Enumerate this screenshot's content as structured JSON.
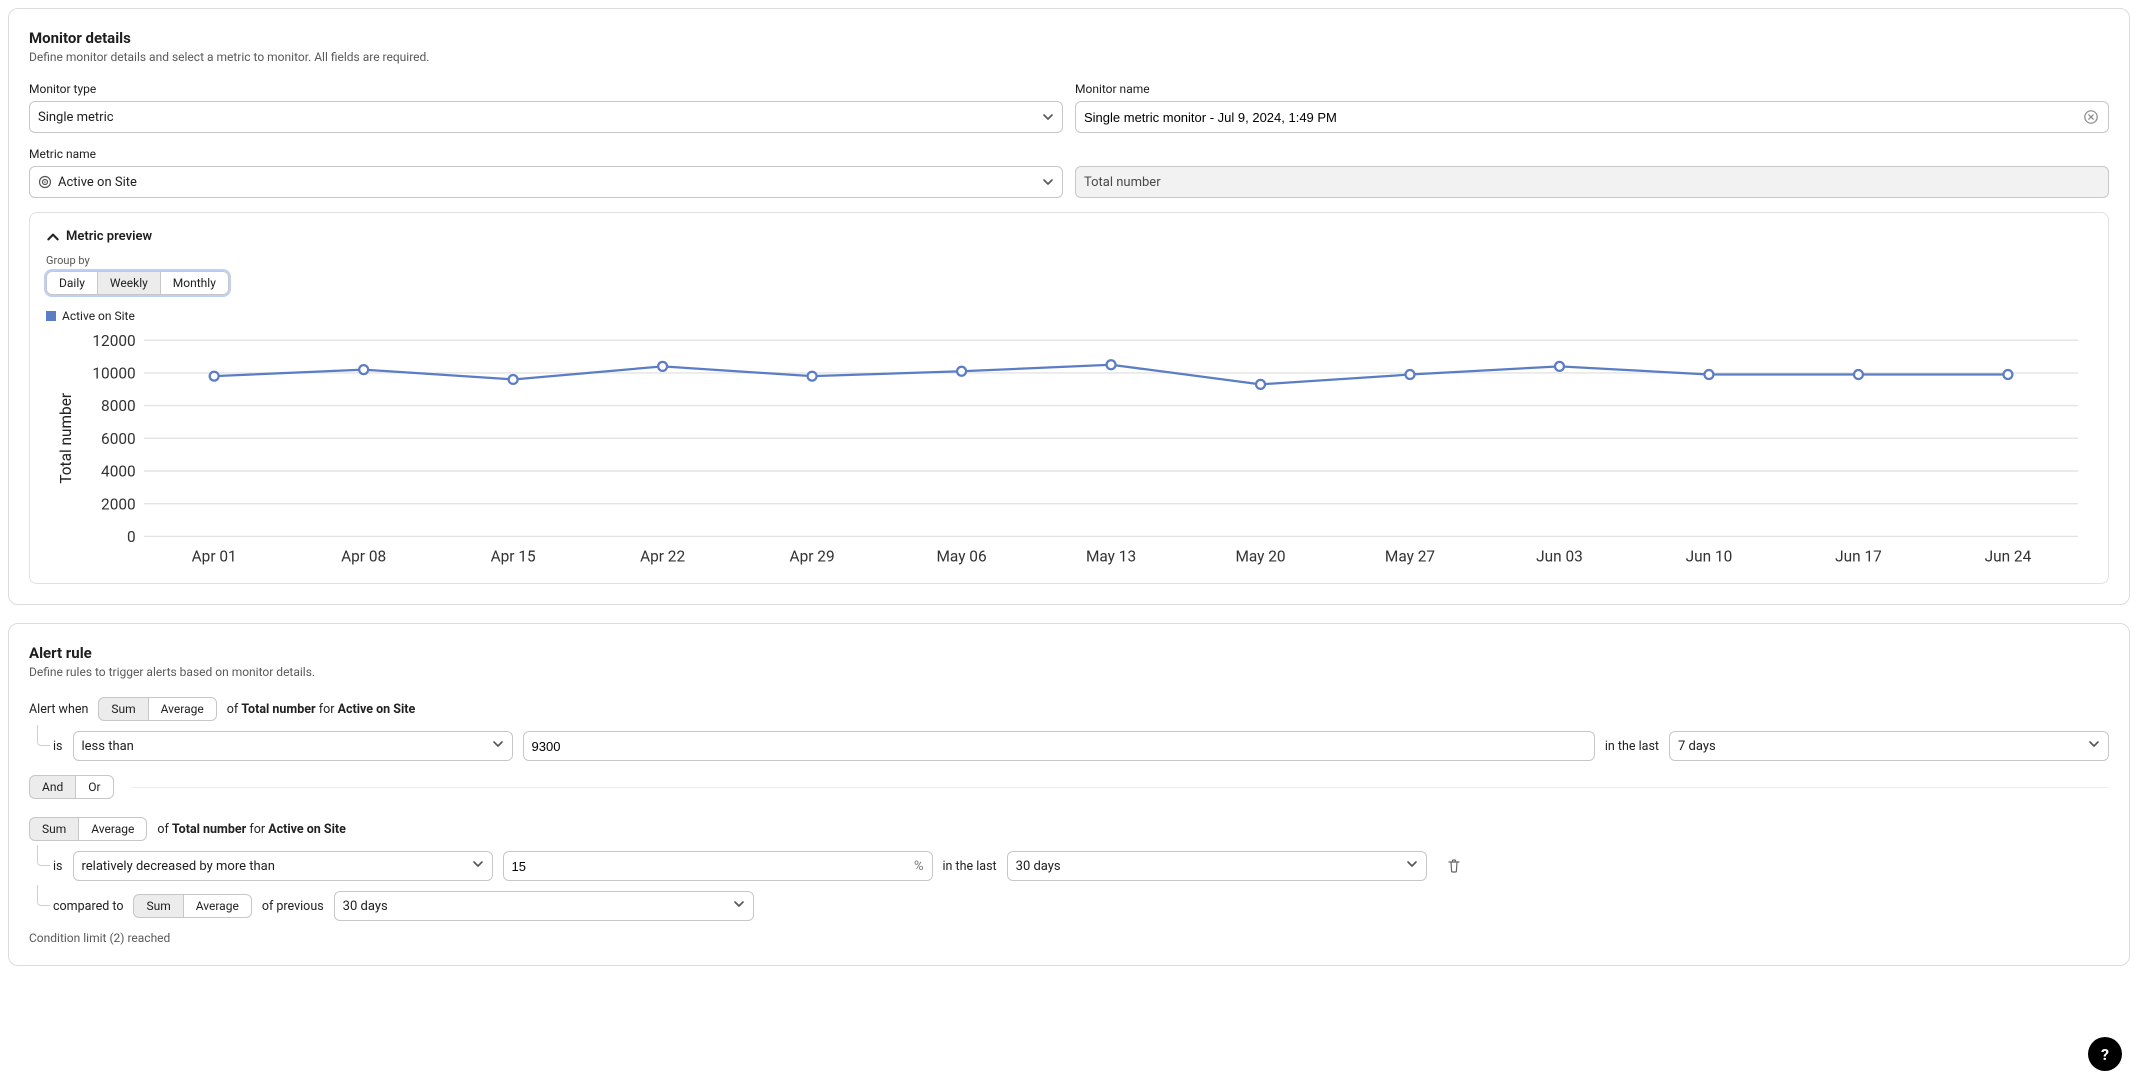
{
  "monitor_details": {
    "title": "Monitor details",
    "subtitle": "Define monitor details and select a metric to monitor. All fields are required.",
    "monitor_type_label": "Monitor type",
    "monitor_type_value": "Single metric",
    "monitor_name_label": "Monitor name",
    "monitor_name_value": "Single metric monitor - Jul 9, 2024, 1:49 PM",
    "metric_name_label": "Metric name",
    "metric_name_value": "Active on Site",
    "metric_agg_value": "Total number"
  },
  "preview": {
    "title": "Metric preview",
    "group_by_label": "Group by",
    "group_by_options": [
      "Daily",
      "Weekly",
      "Monthly"
    ],
    "group_by_active": "Weekly",
    "legend_label": "Active on Site"
  },
  "chart_data": {
    "type": "line",
    "ylabel": "Total number",
    "ylim": [
      0,
      12000
    ],
    "y_ticks": [
      0,
      2000,
      4000,
      6000,
      8000,
      10000,
      12000
    ],
    "categories": [
      "Apr 01",
      "Apr 08",
      "Apr 15",
      "Apr 22",
      "Apr 29",
      "May 06",
      "May 13",
      "May 20",
      "May 27",
      "Jun 03",
      "Jun 10",
      "Jun 17",
      "Jun 24"
    ],
    "series": [
      {
        "name": "Active on Site",
        "values": [
          9800,
          10200,
          9600,
          10400,
          9800,
          10100,
          10500,
          9300,
          9900,
          10400,
          9900,
          9900,
          9900
        ]
      }
    ]
  },
  "alert_rule": {
    "title": "Alert rule",
    "subtitle": "Define rules to trigger alerts based on monitor details.",
    "alert_when_label": "Alert when",
    "sum_label": "Sum",
    "average_label": "Average",
    "of_label": "of",
    "for_label": "for",
    "metric_agg": "Total number",
    "metric_name": "Active on Site",
    "cond1": {
      "is_label": "is",
      "operator": "less than",
      "value": "9300",
      "in_last_label": "in the last",
      "window": "7 days"
    },
    "logic": {
      "and_label": "And",
      "or_label": "Or",
      "active": "Or"
    },
    "cond2": {
      "is_label": "is",
      "operator": "relatively decreased by more than",
      "value": "15",
      "suffix": "%",
      "in_last_label": "in the last",
      "window": "30 days",
      "compared_to_label": "compared to",
      "sum_label": "Sum",
      "average_label": "Average",
      "of_previous_label": "of previous",
      "prev_window": "30 days"
    },
    "condition_limit": "Condition limit (2) reached"
  },
  "help_label": "?"
}
